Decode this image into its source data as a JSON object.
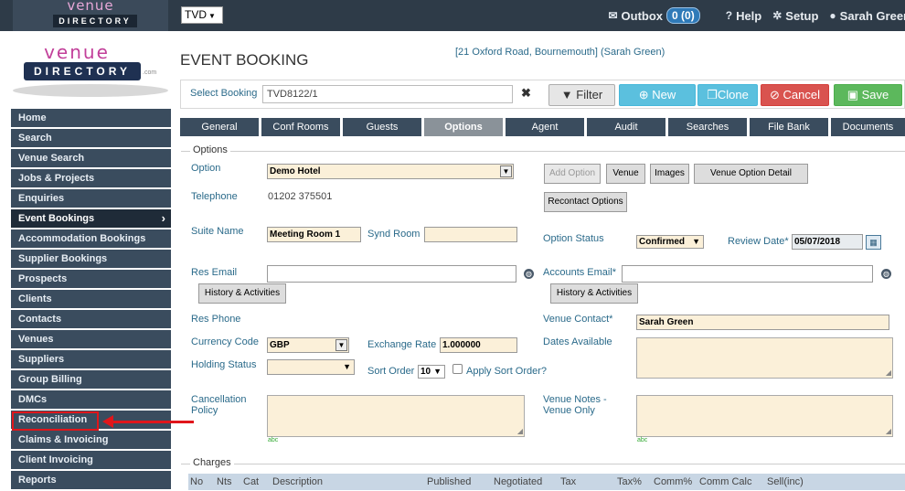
{
  "topbar": {
    "logo_line1": "venue",
    "logo_line2": "DIRECTORY",
    "company_select": "TVD",
    "outbox_label": "Outbox",
    "outbox_count": "0 (0)",
    "help_label": "Help",
    "setup_label": "Setup",
    "user_label": "Sarah Green"
  },
  "side_logo": {
    "line1": "venue",
    "line2": "DIRECTORY",
    "com": ".com"
  },
  "sidebar": {
    "items": [
      {
        "label": "Home"
      },
      {
        "label": "Search"
      },
      {
        "label": "Venue Search"
      },
      {
        "label": "Jobs & Projects"
      },
      {
        "label": "Enquiries"
      },
      {
        "label": "Event Bookings"
      },
      {
        "label": "Accommodation Bookings"
      },
      {
        "label": "Supplier Bookings"
      },
      {
        "label": "Prospects"
      },
      {
        "label": "Clients"
      },
      {
        "label": "Contacts"
      },
      {
        "label": "Venues"
      },
      {
        "label": "Suppliers"
      },
      {
        "label": "Group Billing"
      },
      {
        "label": "DMCs"
      },
      {
        "label": "Reconciliation"
      },
      {
        "label": "Claims & Invoicing"
      },
      {
        "label": "Client Invoicing"
      },
      {
        "label": "Reports"
      }
    ],
    "active": "Event Bookings",
    "highlighted": "Reconciliation"
  },
  "header": {
    "title": "EVENT BOOKING",
    "address": "[21 Oxford Road, Bournemouth] (Sarah Green)"
  },
  "booking_bar": {
    "select_label": "Select Booking",
    "booking_value": "TVD8122/1",
    "filter_label": "Filter",
    "new_label": "New",
    "clone_label": "Clone",
    "cancel_label": "Cancel",
    "save_label": "Save"
  },
  "tabs": [
    "General",
    "Conf Rooms",
    "Guests",
    "Options",
    "Agent",
    "Audit",
    "Searches",
    "File Bank",
    "Documents"
  ],
  "active_tab": "Options",
  "options": {
    "legend": "Options",
    "option_label": "Option",
    "option_value": "Demo Hotel",
    "telephone_label": "Telephone",
    "telephone_value": "01202 375501",
    "suite_label": "Suite Name",
    "suite_value": "Meeting Room 1",
    "synd_label": "Synd Room",
    "synd_value": "",
    "res_email_label": "Res Email",
    "res_email_value": "",
    "history_btn": "History & Activities",
    "res_phone_label": "Res Phone",
    "currency_label": "Currency Code",
    "currency_value": "GBP",
    "exchange_label": "Exchange Rate",
    "exchange_value": "1.000000",
    "holding_label": "Holding Status",
    "holding_value": "",
    "sort_order_label": "Sort Order",
    "sort_order_value": "10",
    "apply_sort_label": "Apply Sort Order?",
    "cancellation_label_1": "Cancellation",
    "cancellation_label_2": "Policy",
    "add_option_btn": "Add Option",
    "venue_btn": "Venue",
    "images_btn": "Images",
    "venue_option_detail_btn": "Venue Option Detail",
    "recontact_btn": "Recontact Options",
    "option_status_label": "Option Status",
    "option_status_value": "Confirmed",
    "review_date_label": "Review Date*",
    "review_date_value": "05/07/2018",
    "accounts_email_label": "Accounts Email*",
    "accounts_email_value": "",
    "history_btn_2": "History & Activities",
    "venue_contact_label": "Venue Contact*",
    "venue_contact_value": "Sarah Green",
    "dates_available_label": "Dates Available",
    "venue_notes_label_1": "Venue Notes -",
    "venue_notes_label_2": "Venue Only",
    "spell_mark": "abc"
  },
  "charges": {
    "legend": "Charges",
    "columns": [
      "No",
      "Nts",
      "Cat",
      "Description",
      "Published",
      "Negotiated",
      "Tax",
      "Tax%",
      "Comm%",
      "Comm Calc",
      "Sell(inc)"
    ]
  }
}
